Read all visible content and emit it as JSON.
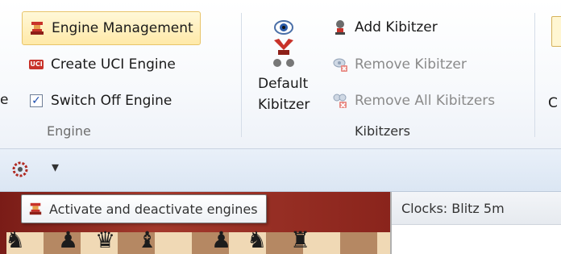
{
  "ribbon": {
    "engine_group": {
      "label": "Engine",
      "items": [
        {
          "label": "Engine Management",
          "icon": "engine-management-icon"
        },
        {
          "label": "Create UCI Engine",
          "icon": "uci-icon",
          "badge": "UCI"
        },
        {
          "label": "Switch Off Engine",
          "icon": "checkbox",
          "checked": true
        }
      ],
      "partial_left": "e"
    },
    "kibitzers_group": {
      "label": "Kibitzers",
      "default_kibitzer": {
        "line1": "Default",
        "line2": "Kibitzer"
      },
      "items": [
        {
          "label": "Add Kibitzer",
          "icon": "add-kibitzer-icon",
          "enabled": true
        },
        {
          "label": "Remove Kibitzer",
          "icon": "remove-kibitzer-icon",
          "enabled": false
        },
        {
          "label": "Remove All Kibitzers",
          "icon": "remove-all-kibitzers-icon",
          "enabled": false
        }
      ]
    },
    "partial_right": "C"
  },
  "quick_access": {
    "dropdown_glyph": "▾"
  },
  "tooltip": {
    "text": "Activate and deactivate engines"
  },
  "clocks": {
    "title": "Clocks: Blitz 5m"
  },
  "colors": {
    "highlight": "#ffe9a8",
    "disabled_text": "#8a8a8a",
    "board_frame": "#a3392c"
  }
}
